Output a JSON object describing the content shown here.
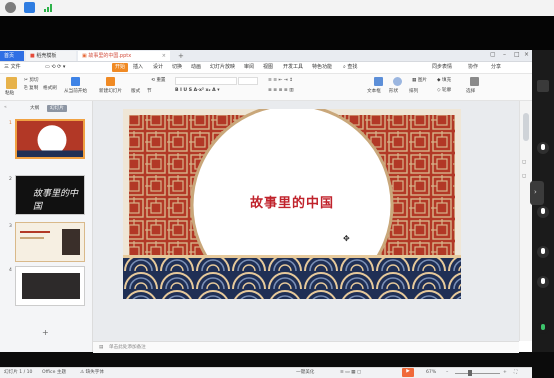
{
  "app": {
    "tabs": [
      {
        "label": "首页"
      },
      {
        "label": "稻壳模板"
      },
      {
        "label": "故事里的中国.pptx"
      }
    ],
    "menu": [
      "三 文件",
      "开始",
      "插入",
      "设计",
      "切换",
      "动画",
      "幻灯片放映",
      "审阅",
      "视图",
      "开发工具",
      "特色功能"
    ],
    "search_label": "查找",
    "right_menu": [
      "同步表情",
      "协作",
      "分享"
    ],
    "ribbon": {
      "paste": "粘贴",
      "cut": "剪切",
      "copy": "复制",
      "format_painter": "格式刷",
      "from_current": "从当前开始",
      "new_slide": "新建幻灯片",
      "layout": "版式",
      "section": "节",
      "reset": "重置",
      "textbox": "文本框",
      "shape": "形状",
      "arrange": "排列",
      "picture": "图片",
      "fill": "填充",
      "outline": "轮廓",
      "select": "选择"
    },
    "left_pane": {
      "tab_outline": "大纲",
      "tab_slides": "幻灯片",
      "thumb_numbers": [
        "1",
        "2",
        "3",
        "4"
      ],
      "slide2_text": "故事里的中国",
      "add_label": "+"
    },
    "slide": {
      "title": "故事里的中国",
      "colors": {
        "red": "#b23826",
        "title": "#c0232c",
        "navy": "#1f2f55"
      }
    },
    "notes_placeholder": "单击此处添加备注",
    "status": {
      "slide_info": "幻灯片 1 / 10",
      "theme": "Office 主题",
      "missing_font": "缺失字体",
      "beautify": "一键美化",
      "zoom": "67%"
    }
  }
}
